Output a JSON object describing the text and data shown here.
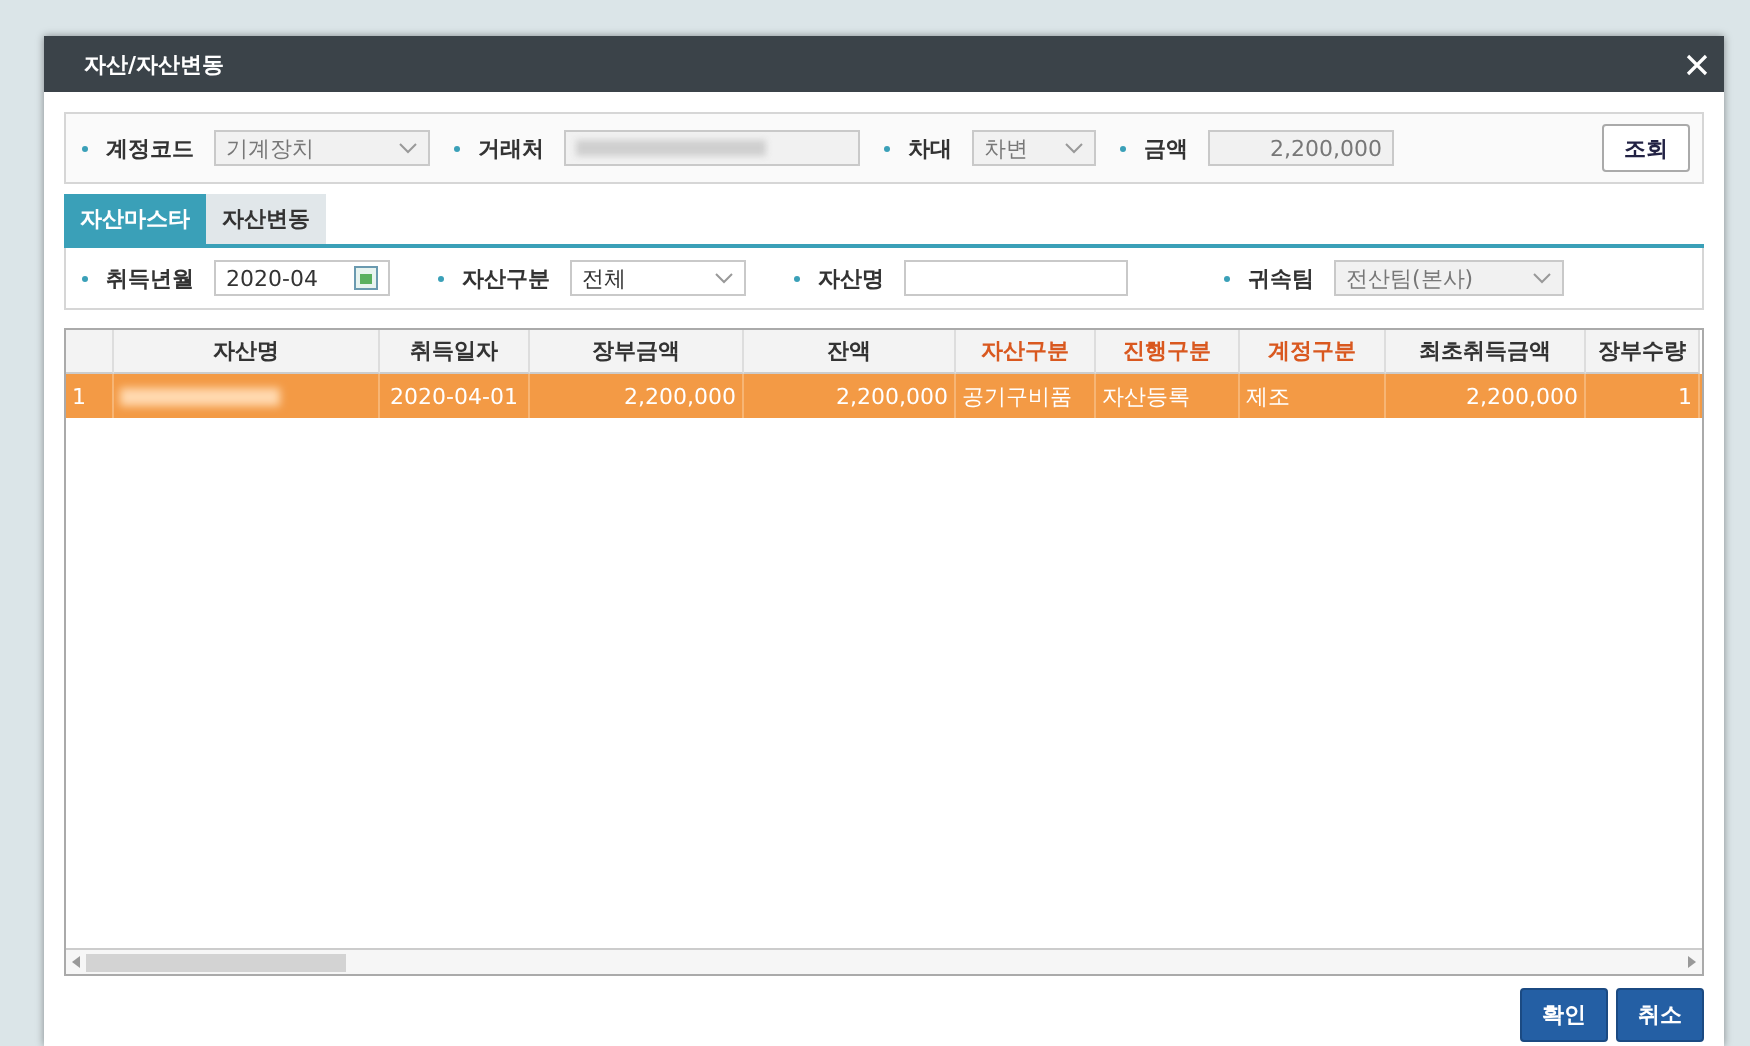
{
  "window": {
    "title": "자산/자산변동"
  },
  "search_panel": {
    "fields": [
      {
        "label": "계정코드",
        "kind": "select",
        "value": "기계장치",
        "disabled": true
      },
      {
        "label": "거래처",
        "kind": "redacted",
        "disabled": true
      },
      {
        "label": "차대",
        "kind": "select",
        "value": "차변",
        "disabled": true
      },
      {
        "label": "금액",
        "kind": "number",
        "value": "2,200,000",
        "disabled": true
      }
    ],
    "button": "조회"
  },
  "tabs": [
    {
      "label": "자산마스타",
      "selected": true
    },
    {
      "label": "자산변동",
      "selected": false
    }
  ],
  "filter_panel": {
    "fields": [
      {
        "label": "취득년월",
        "kind": "date",
        "value": "2020-04",
        "disabled": false
      },
      {
        "label": "자산구분",
        "kind": "select",
        "value": "전체",
        "disabled": false
      },
      {
        "label": "자산명",
        "kind": "text",
        "disabled": false
      },
      {
        "label": "귀속팀",
        "kind": "select",
        "value": "전산팀(본사)",
        "disabled": true
      }
    ]
  },
  "table": {
    "columns": [
      {
        "label": "자산명",
        "kind": "text",
        "color": "#333333"
      },
      {
        "label": "취득일자",
        "kind": "date",
        "color": "#333333"
      },
      {
        "label": "장부금액",
        "kind": "amount",
        "color": "#333333"
      },
      {
        "label": "잔액",
        "kind": "amount",
        "color": "#333333"
      },
      {
        "label": "자산구분",
        "kind": "text",
        "color": "#d9581f"
      },
      {
        "label": "진행구분",
        "kind": "text",
        "color": "#d9581f"
      },
      {
        "label": "계정구분",
        "kind": "text",
        "color": "#d9581f"
      },
      {
        "label": "최초취득금액",
        "kind": "amount",
        "color": "#333333"
      },
      {
        "label": "장부수량",
        "kind": "amount",
        "color": "#333333"
      }
    ],
    "rows": [
      {
        "number": "1",
        "selected": true,
        "cells": [
          null,
          "2020-04-01",
          "2,200,000",
          "2,200,000",
          "공기구비품",
          "자산등록",
          "제조",
          "2,200,000",
          "1"
        ]
      }
    ]
  },
  "buttons": [
    "확인",
    "취소"
  ]
}
